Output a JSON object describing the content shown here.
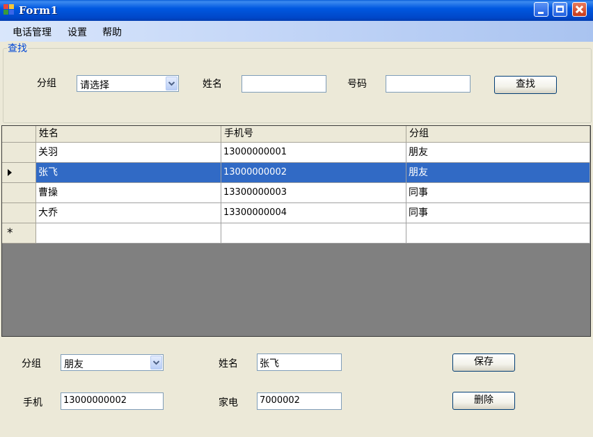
{
  "window": {
    "title": "Form1"
  },
  "menu": {
    "items": [
      "电话管理",
      "设置",
      "帮助"
    ]
  },
  "search": {
    "legend": "查找",
    "group_label": "分组",
    "group_value": "请选择",
    "name_label": "姓名",
    "name_value": "",
    "number_label": "号码",
    "number_value": "",
    "search_button": "查找"
  },
  "grid": {
    "columns": [
      "姓名",
      "手机号",
      "分组"
    ],
    "rows": [
      {
        "name": "关羽",
        "phone": "13000000001",
        "group": "朋友"
      },
      {
        "name": "张飞",
        "phone": "13000000002",
        "group": "朋友"
      },
      {
        "name": "曹操",
        "phone": "13300000003",
        "group": "同事"
      },
      {
        "name": "大乔",
        "phone": "13300000004",
        "group": "同事"
      }
    ],
    "selected_row": 1,
    "new_row_marker": "*"
  },
  "detail": {
    "group_label": "分组",
    "group_value": "朋友",
    "name_label": "姓名",
    "name_value": "张飞",
    "mobile_label": "手机",
    "mobile_value": "13000000002",
    "home_label": "家电",
    "home_value": "7000002",
    "save_button": "保存",
    "delete_button": "删除"
  },
  "colors": {
    "titlebar": "#0054E3",
    "menubar": "#C6D8F8",
    "form_bg": "#ECE9D8",
    "selection": "#316AC5",
    "grid_empty": "#808080"
  },
  "icons": [
    "app-icon",
    "minimize-icon",
    "maximize-icon",
    "close-icon",
    "dropdown-arrow-icon",
    "current-row-arrow-icon",
    "new-row-star-icon"
  ]
}
